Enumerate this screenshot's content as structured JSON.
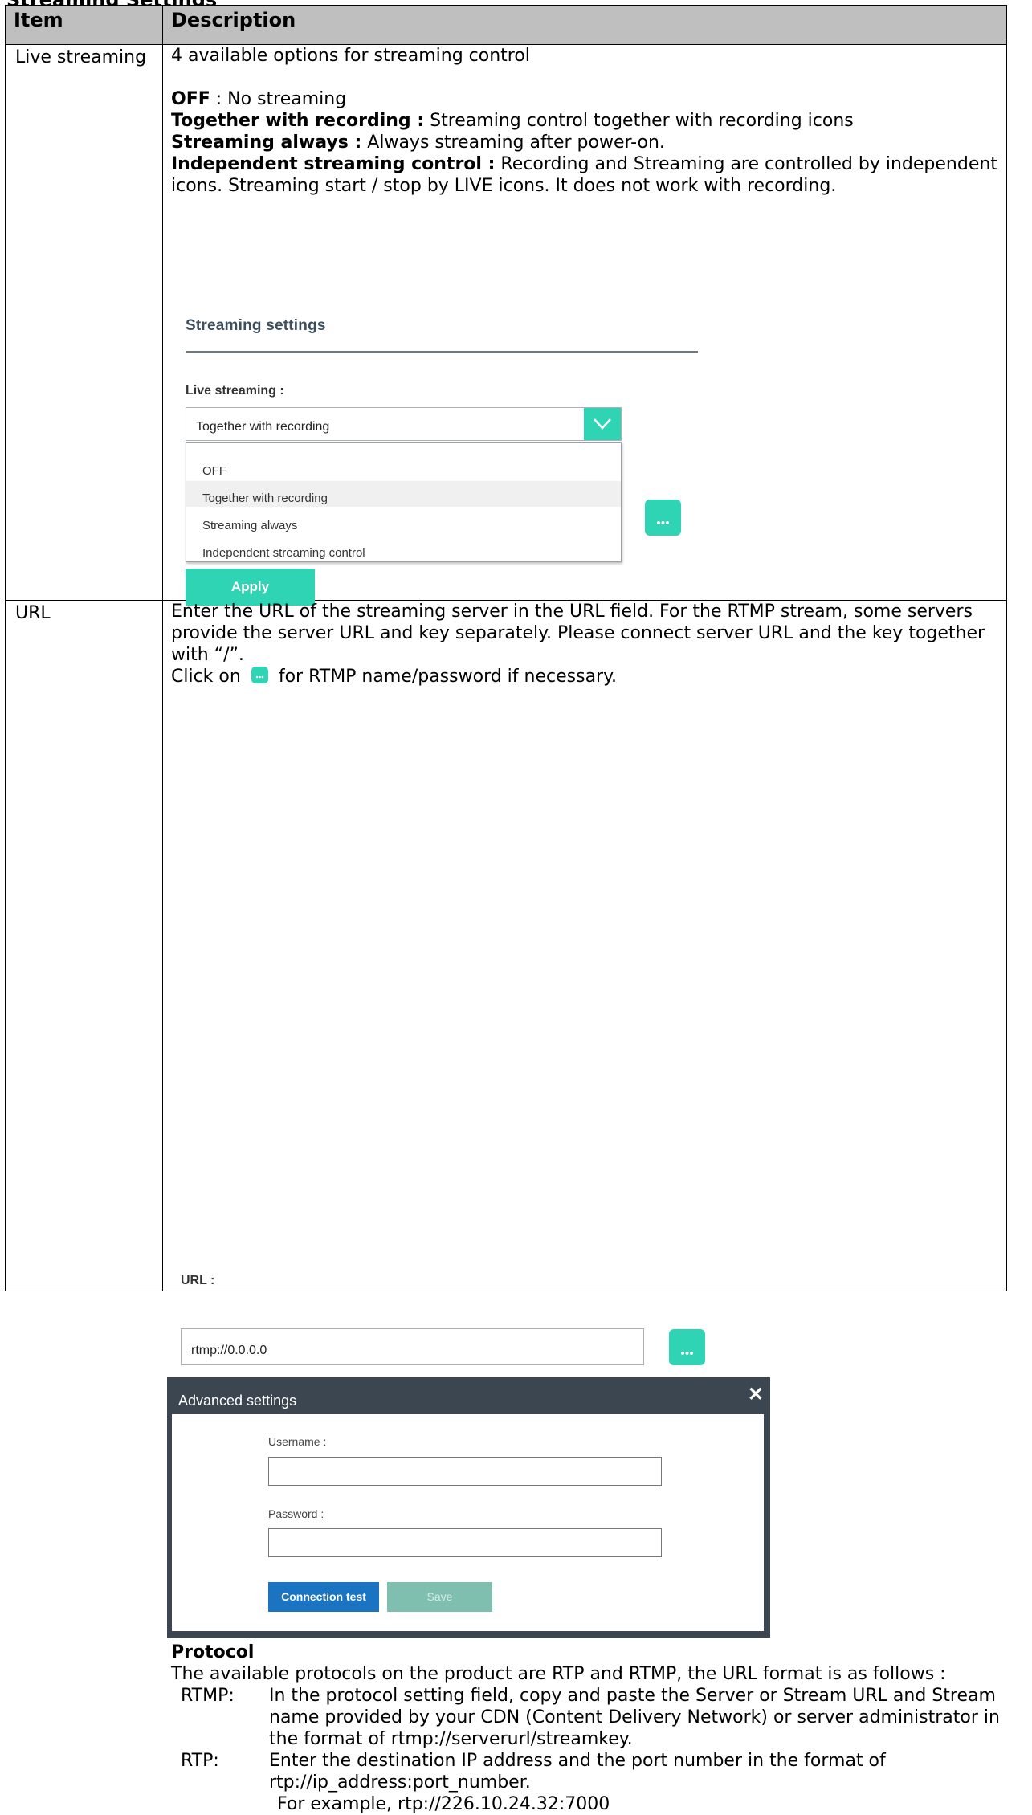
{
  "page_heading": "Streaming Settings",
  "table": {
    "header_item": "Item",
    "header_description": "Description"
  },
  "row_live": {
    "item": "Live streaming",
    "intro": "4 available options for streaming control",
    "options": [
      {
        "name": "OFF",
        "sep": " : ",
        "text": "No streaming"
      },
      {
        "name": "Together with recording :",
        "sep": " ",
        "text": "Streaming control together with recording icons"
      },
      {
        "name": "Streaming always :",
        "sep": " ",
        "text": "Always streaming after power-on."
      },
      {
        "name": "Independent streaming control :",
        "sep": " ",
        "text": "Recording and Streaming are controlled by independent icons. Streaming start / stop by LIVE icons. It does not work with recording."
      }
    ],
    "panel": {
      "title": "Streaming settings",
      "field_label": "Live streaming :",
      "selected_value": "Together with recording",
      "dropdown_options": [
        "OFF",
        "Together with recording",
        "Streaming always",
        "Independent streaming control"
      ],
      "highlighted_index": 1,
      "apply_label": "Apply"
    }
  },
  "row_url": {
    "item": "URL",
    "para1": "Enter the URL of the streaming server in the URL field. For the RTMP stream, some servers provide the server URL and key separately. Please connect server URL and the key together with “/”.",
    "click_before": "Click on",
    "click_after": "for RTMP name/password if necessary.",
    "url_label": "URL :",
    "url_value": "rtmp://0.0.0.0",
    "dialog": {
      "title": "Advanced settings",
      "close_glyph": "✕",
      "username_label": "Username :",
      "password_label": "Password :",
      "connection_test_label": "Connection test",
      "save_label": "Save"
    },
    "protocol": {
      "heading": "Protocol",
      "intro": "The available protocols on the product are RTP and RTMP, the URL format is as follows :",
      "rtmp_key": "RTMP:",
      "rtmp_text": "In the protocol setting field, copy and paste the Server or Stream URL and Stream name provided by your CDN (Content Delivery Network) or server administrator in the format of rtmp://serverurl/streamkey.",
      "rtp_key": "RTP:",
      "rtp_text": "Enter the destination IP address and the port number in the format of rtp://ip_address:port_number.",
      "example": "For example, rtp://226.10.24.32:7000"
    }
  },
  "colors": {
    "accent_teal": "#2fd4b5",
    "header_gray": "#bfbfbf",
    "dialog_dark": "#3b4650",
    "button_blue": "#1b74c2"
  },
  "icons": [
    "chevron-down-icon",
    "more-dots-icon",
    "close-icon"
  ]
}
